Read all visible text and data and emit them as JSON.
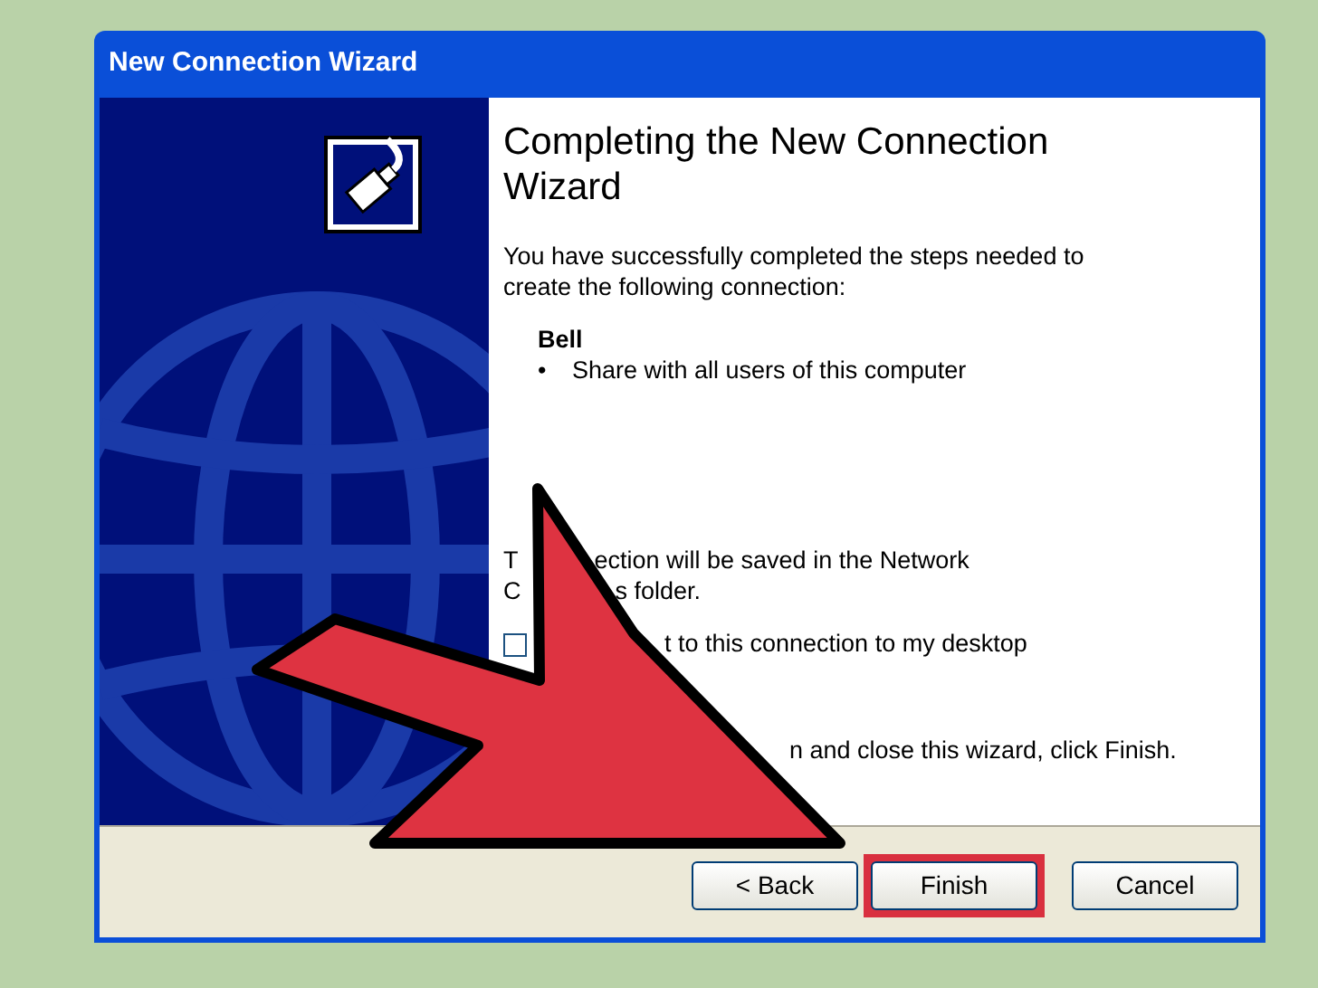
{
  "window": {
    "title": "New Connection Wizard"
  },
  "heading": "Completing the New Connection Wizard",
  "intro": "You have successfully completed the steps needed to create the following connection:",
  "connection": {
    "name": "Bell",
    "details": [
      {
        "bullet": "•",
        "text": "Share with all users of this computer"
      }
    ]
  },
  "partly_covered_lines": [
    {
      "kind": "text",
      "visible_parts": [
        "T",
        "ection will be saved in the Network"
      ]
    },
    {
      "kind": "text",
      "visible_parts": [
        "C",
        "s folder."
      ]
    },
    {
      "kind": "checkbox",
      "checked": false,
      "visible_parts": [
        "t to this connection to my desktop"
      ]
    },
    {
      "kind": "text",
      "visible_parts": [
        "n and close this wizard, click Finish."
      ]
    }
  ],
  "buttons": [
    {
      "label": "< Back",
      "highlighted": false
    },
    {
      "label": "Finish",
      "highlighted": true
    },
    {
      "label": "Cancel",
      "highlighted": false
    }
  ]
}
